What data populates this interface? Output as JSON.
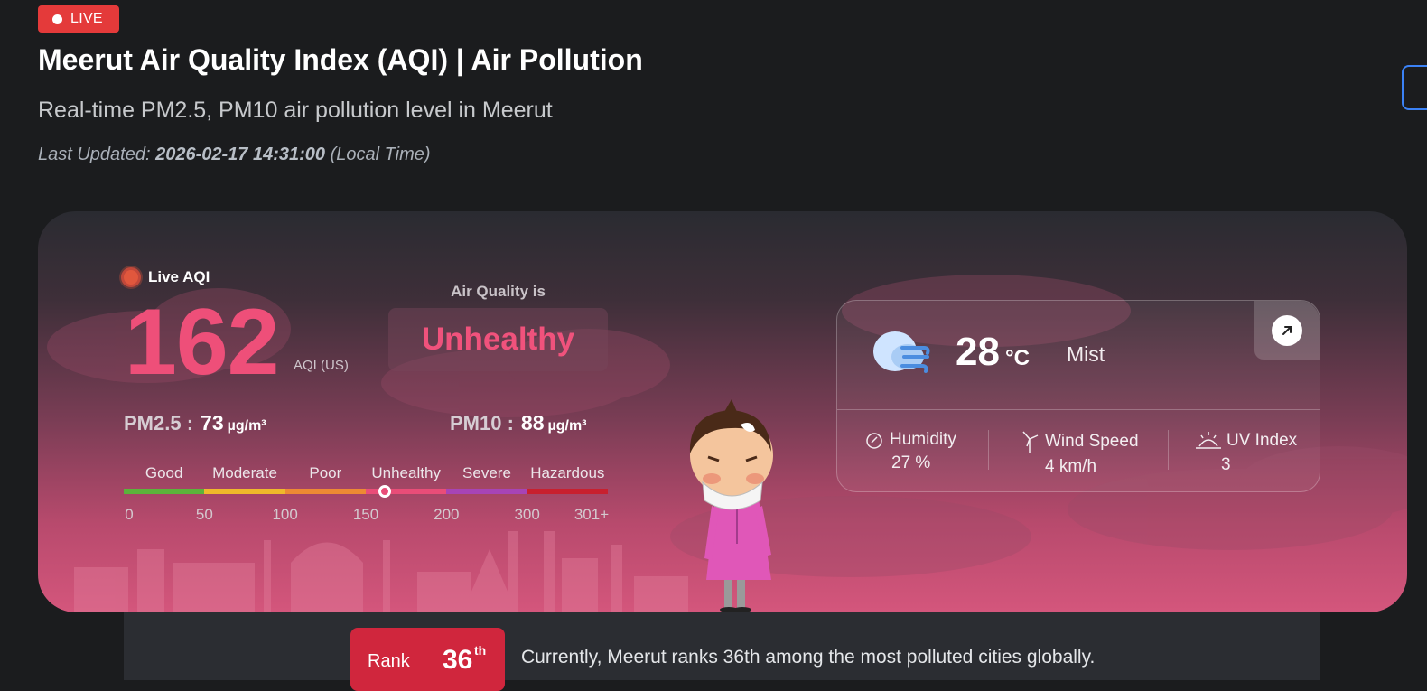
{
  "header": {
    "live_badge": "LIVE",
    "title": "Meerut Air Quality Index (AQI) | Air Pollution",
    "subtitle": "Real-time PM2.5, PM10 air pollution level in Meerut",
    "updated_prefix": "Last Updated: ",
    "updated_time": "2026-02-17 14:31:00",
    "updated_suffix": " (Local Time)"
  },
  "aqi": {
    "live_label": "Live AQI",
    "value": "162",
    "unit": "AQI (US)",
    "quality_label": "Air Quality is",
    "quality_status": "Unhealthy",
    "status_color": "#f0527c"
  },
  "pollutants": {
    "pm25_label": "PM2.5 :",
    "pm25_value": "73",
    "pm25_unit": "µg/m³",
    "pm10_label": "PM10 :",
    "pm10_value": "88",
    "pm10_unit": "µg/m³"
  },
  "scale": {
    "categories": [
      "Good",
      "Moderate",
      "Poor",
      "Unhealthy",
      "Severe",
      "Hazardous"
    ],
    "colors": [
      "#5bb33b",
      "#efb92b",
      "#ed8a33",
      "#e94d78",
      "#a744b5",
      "#c8202f"
    ],
    "numbers": [
      "0",
      "50",
      "100",
      "150",
      "200",
      "300",
      "301+"
    ],
    "marker_value": 162
  },
  "weather": {
    "temperature": "28",
    "temperature_unit": "°C",
    "condition": "Mist",
    "icon": "cloud-wind-icon",
    "humidity_label": "Humidity",
    "humidity_value": "27 %",
    "wind_label": "Wind Speed",
    "wind_value": "4 km/h",
    "uv_label": "UV Index",
    "uv_value": "3"
  },
  "rank": {
    "label": "Rank",
    "number": "36",
    "suffix": "th",
    "text": "Currently, Meerut ranks 36th among the most polluted cities globally."
  }
}
